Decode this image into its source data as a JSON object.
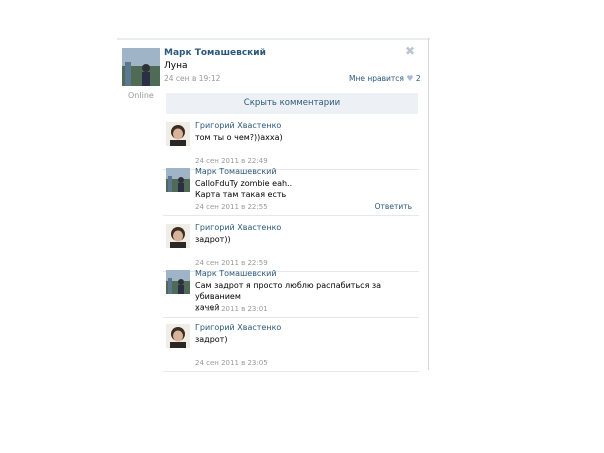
{
  "post": {
    "author": "Марк Томашевский",
    "text": "Луна",
    "date": "24 сен в 19:12",
    "status": "Online",
    "like_label": "Мне нравится",
    "like_count": "2",
    "close_icon": "close-icon"
  },
  "hide_comments_label": "Скрыть комментарии",
  "comments": [
    {
      "author": "Григорий Хвастенко",
      "text": "том ты о чем?))ахха)",
      "date": "24 сен 2011 в 22:49",
      "avatar": "grigoriy"
    },
    {
      "author": "Марк Томашевский",
      "text_line1": "CalloFduTy zombie eah..",
      "text_line2": "Карта там такая есть",
      "date": "24 сен 2011 в 22:55",
      "reply_label": "Ответить",
      "avatar": "mark"
    },
    {
      "author": "Григорий Хвастенко",
      "text": "задрот))",
      "date": "24 сен 2011 в 22:59",
      "avatar": "grigoriy"
    },
    {
      "author": "Марк Томашевский",
      "text_line1": "Сам задрот я просто люблю распабиться за убиванием",
      "text_line2": "хачей",
      "date": "24 сен 2011 в 23:01",
      "avatar": "mark"
    },
    {
      "author": "Григорий Хвастенко",
      "text": "задрот)",
      "date": "24 сен 2011 в 23:05",
      "avatar": "grigoriy"
    }
  ]
}
